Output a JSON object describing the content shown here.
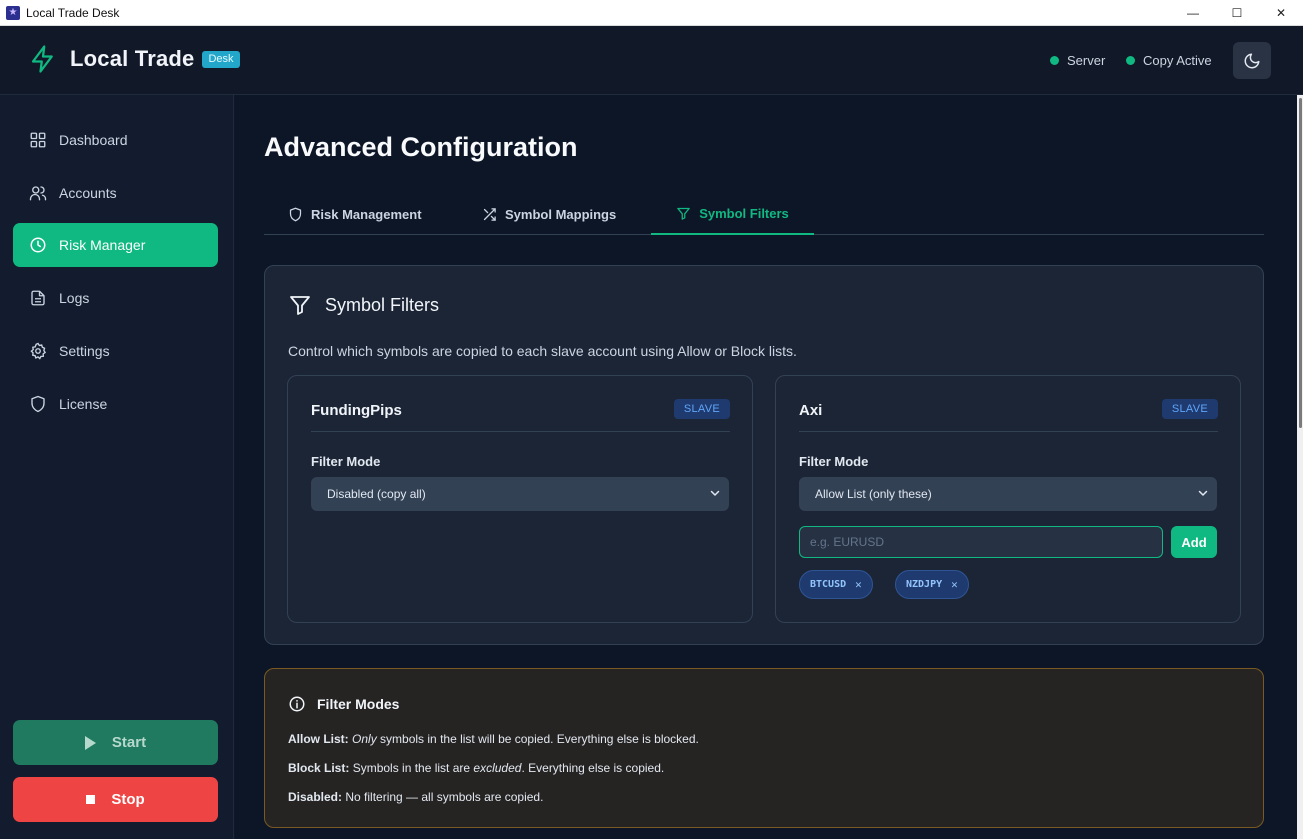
{
  "window": {
    "title": "Local Trade Desk",
    "controls": {
      "minimize": "—",
      "maximize": "☐",
      "close": "✕"
    }
  },
  "header": {
    "brand_name": "Local Trade",
    "brand_badge": "Desk",
    "status_server": "Server",
    "status_copy": "Copy Active",
    "theme_icon": "moon-icon",
    "accent_color": "#10b981"
  },
  "sidebar": {
    "items": [
      {
        "label": "Dashboard",
        "icon": "grid-icon"
      },
      {
        "label": "Accounts",
        "icon": "users-icon"
      },
      {
        "label": "Risk Manager",
        "icon": "clock-icon",
        "active": true
      },
      {
        "label": "Logs",
        "icon": "document-icon"
      },
      {
        "label": "Settings",
        "icon": "gear-icon"
      },
      {
        "label": "License",
        "icon": "shield-icon"
      }
    ],
    "start_label": "Start",
    "stop_label": "Stop"
  },
  "main": {
    "title": "Advanced Configuration",
    "tabs": [
      {
        "label": "Risk Management",
        "icon": "shield-icon"
      },
      {
        "label": "Symbol Mappings",
        "icon": "shuffle-icon"
      },
      {
        "label": "Symbol Filters",
        "icon": "filter-icon",
        "active": true
      }
    ],
    "card": {
      "title": "Symbol Filters",
      "description": "Control which symbols are copied to each slave account using Allow or Block lists.",
      "accounts": [
        {
          "name": "FundingPips",
          "badge": "SLAVE",
          "filter_label": "Filter Mode",
          "filter_value": "Disabled (copy all)"
        },
        {
          "name": "Axi",
          "badge": "SLAVE",
          "filter_label": "Filter Mode",
          "filter_value": "Allow List (only these)",
          "input_placeholder": "e.g. EURUSD",
          "add_label": "Add",
          "symbols": [
            "BTCUSD",
            "NZDJPY"
          ],
          "remove_glyph": "✕"
        }
      ]
    },
    "info": {
      "title": "Filter Modes",
      "allow_term": "Allow List:",
      "allow_em": "Only",
      "allow_rest": "symbols in the list will be copied. Everything else is blocked.",
      "block_term": "Block List:",
      "block_pre": "Symbols in the list are",
      "block_em": "excluded",
      "block_rest": ". Everything else is copied.",
      "disabled_term": "Disabled:",
      "disabled_rest": "No filtering — all symbols are copied."
    }
  }
}
